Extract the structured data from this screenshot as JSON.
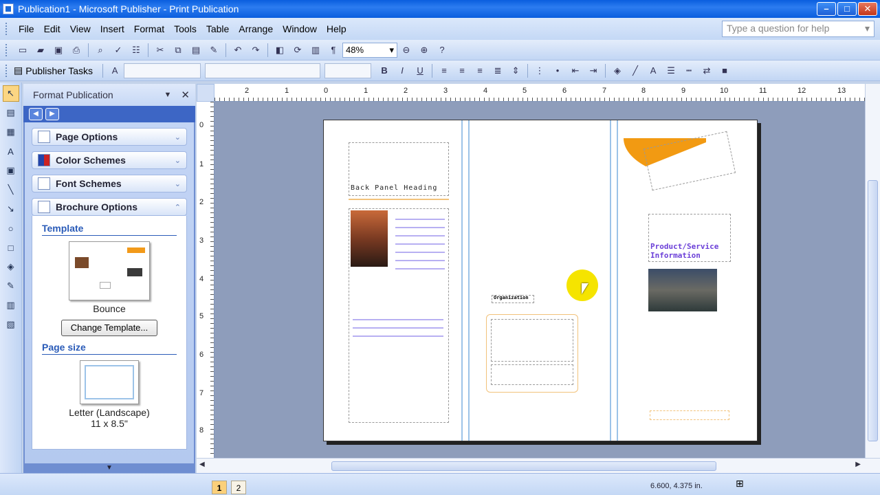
{
  "window": {
    "title": "Publication1 - Microsoft Publisher - Print Publication"
  },
  "menu": [
    "File",
    "Edit",
    "View",
    "Insert",
    "Format",
    "Tools",
    "Table",
    "Arrange",
    "Window",
    "Help"
  ],
  "ask": {
    "placeholder": "Type a question for help"
  },
  "toolbar": {
    "zoom": "48%",
    "publisher_tasks": "Publisher Tasks"
  },
  "task_pane": {
    "title": "Format Publication",
    "sections": [
      "Page Options",
      "Color Schemes",
      "Font Schemes",
      "Brochure Options"
    ],
    "template_label": "Template",
    "template_name": "Bounce",
    "change_template": "Change Template...",
    "page_size_label": "Page size",
    "page_size_name": "Letter (Landscape)",
    "page_size_dims": "11 x 8.5\""
  },
  "ruler": {
    "h": [
      "2",
      "1",
      "0",
      "1",
      "2",
      "3",
      "4",
      "5",
      "6",
      "7",
      "8",
      "9",
      "10",
      "11",
      "12",
      "13"
    ],
    "v": [
      "0",
      "1",
      "2",
      "3",
      "4",
      "5",
      "6",
      "7",
      "8"
    ]
  },
  "brochure": {
    "back_panel_heading": "Back Panel Heading",
    "product_info": "Product/Service Information",
    "organization": "Organization"
  },
  "status": {
    "pages": [
      "1",
      "2"
    ],
    "active_page": "1",
    "coords": "6.600, 4.375 in."
  },
  "colors": {
    "accent_orange": "#f29a12",
    "title_blue": "#0a5ede",
    "workspace": "#8e9dbb"
  }
}
